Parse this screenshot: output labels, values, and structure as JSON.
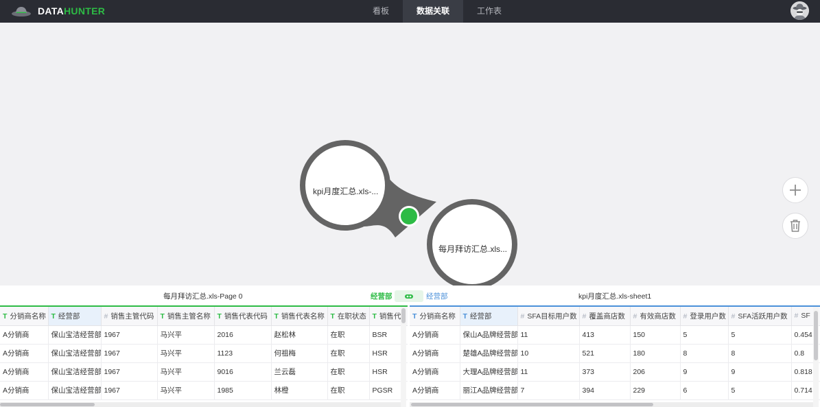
{
  "app": {
    "brand_part1": "DATA",
    "brand_part2": "HUNTER",
    "brand_color": "#2dbb45",
    "header_bg": "#2a2c33"
  },
  "nav": {
    "tabs": [
      {
        "label": "看板",
        "active": false
      },
      {
        "label": "数据关联",
        "active": true
      },
      {
        "label": "工作表",
        "active": false
      }
    ]
  },
  "canvas": {
    "node_a_label": "kpi月度汇总.xls-...",
    "node_b_label": "每月拜访汇总.xls...",
    "link_color": "#2dbb45",
    "add_icon": "plus-icon",
    "delete_icon": "trash-icon"
  },
  "panel": {
    "left_source": "每月拜访汇总.xls-Page 0",
    "left_join_field": "经营部",
    "right_join_field": "经营部",
    "right_source": "kpi月度汇总.xls-sheet1",
    "left_table": {
      "columns": [
        {
          "type": "T",
          "label": "分销商名称"
        },
        {
          "type": "T",
          "label": "经营部"
        },
        {
          "type": "#",
          "label": "销售主管代码"
        },
        {
          "type": "T",
          "label": "销售主管名称"
        },
        {
          "type": "T",
          "label": "销售代表代码"
        },
        {
          "type": "T",
          "label": "销售代表名称"
        },
        {
          "type": "T",
          "label": "在职状态"
        },
        {
          "type": "T",
          "label": "销售代"
        }
      ],
      "rows": [
        [
          "A分销商",
          "保山宝洁经营部",
          "1967",
          "马兴平",
          "2016",
          "赵松林",
          "在职",
          "BSR"
        ],
        [
          "A分销商",
          "保山宝洁经营部",
          "1967",
          "马兴平",
          "1123",
          "何祖梅",
          "在职",
          "HSR"
        ],
        [
          "A分销商",
          "保山宝洁经营部",
          "1967",
          "马兴平",
          "9016",
          "兰云磊",
          "在职",
          "HSR"
        ],
        [
          "A分销商",
          "保山宝洁经营部",
          "1967",
          "马兴平",
          "1985",
          "林橙",
          "在职",
          "PGSR"
        ]
      ]
    },
    "right_table": {
      "columns": [
        {
          "type": "T",
          "label": "分销商名称"
        },
        {
          "type": "T",
          "label": "经营部"
        },
        {
          "type": "#",
          "label": "SFA目标用户数"
        },
        {
          "type": "#",
          "label": "覆盖商店数"
        },
        {
          "type": "#",
          "label": "有效商店数"
        },
        {
          "type": "#",
          "label": "登录用户数"
        },
        {
          "type": "#",
          "label": "SFA活跃用户数"
        },
        {
          "type": "#",
          "label": "SF"
        }
      ],
      "rows": [
        [
          "A分销商",
          "保山A品牌经营部",
          "11",
          "413",
          "150",
          "5",
          "5",
          "0.454"
        ],
        [
          "A分销商",
          "楚雄A品牌经营部",
          "10",
          "521",
          "180",
          "8",
          "8",
          "0.8"
        ],
        [
          "A分销商",
          "大理A品牌经营部",
          "11",
          "373",
          "206",
          "9",
          "9",
          "0.818"
        ],
        [
          "A分销商",
          "丽江A品牌经营部",
          "7",
          "394",
          "229",
          "6",
          "5",
          "0.714"
        ]
      ]
    }
  }
}
